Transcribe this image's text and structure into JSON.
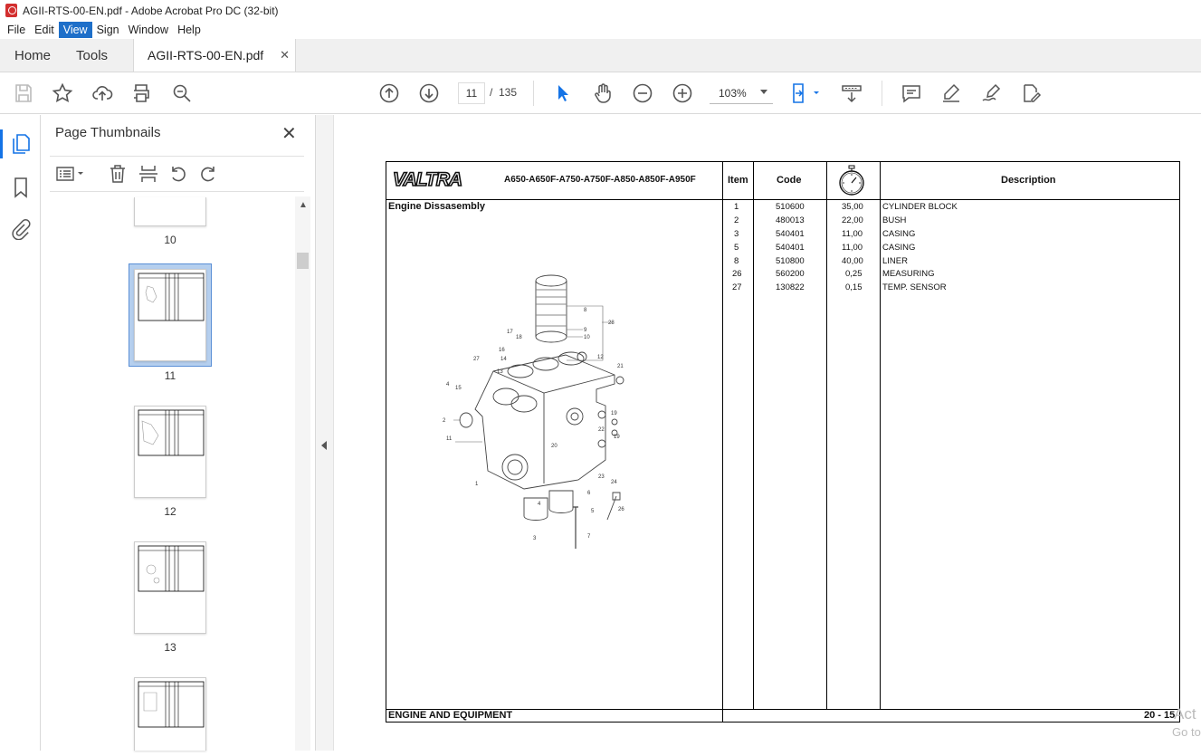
{
  "window": {
    "title": "AGII-RTS-00-EN.pdf - Adobe Acrobat Pro DC (32-bit)"
  },
  "menu": {
    "items": [
      "File",
      "Edit",
      "View",
      "Sign",
      "Window",
      "Help"
    ],
    "active": "View"
  },
  "tabs": {
    "home": "Home",
    "tools": "Tools",
    "document": "AGII-RTS-00-EN.pdf"
  },
  "toolbar": {
    "current_page": "11",
    "page_separator": "/",
    "total_pages": "135",
    "zoom": "103%"
  },
  "thumbnails": {
    "title": "Page Thumbnails",
    "pages": [
      {
        "label": "10"
      },
      {
        "label": "11",
        "selected": true
      },
      {
        "label": "12"
      },
      {
        "label": "13"
      }
    ]
  },
  "document": {
    "brand": "VALTRA",
    "models": "A650-A650F-A750-A750F-A850-A850F-A950F",
    "section_title": "Engine Dissasembly",
    "columns": {
      "item": "Item",
      "code": "Code",
      "description": "Description"
    },
    "rows": [
      {
        "item": "1",
        "code": "510600",
        "time": "35,00",
        "description": "CYLINDER BLOCK"
      },
      {
        "item": "2",
        "code": "480013",
        "time": "22,00",
        "description": "BUSH"
      },
      {
        "item": "3",
        "code": "540401",
        "time": "11,00",
        "description": "CASING"
      },
      {
        "item": "5",
        "code": "540401",
        "time": "11,00",
        "description": "CASING"
      },
      {
        "item": "8",
        "code": "510800",
        "time": "40,00",
        "description": "LINER"
      },
      {
        "item": "26",
        "code": "560200",
        "time": "0,25",
        "description": "MEASURING"
      },
      {
        "item": "27",
        "code": "130822",
        "time": "0,15",
        "description": "TEMP. SENSOR"
      }
    ],
    "footer_left": "ENGINE AND EQUIPMENT",
    "footer_right": "20 - 15",
    "diagram_callouts": [
      "8",
      "9",
      "10",
      "28",
      "17",
      "18",
      "16",
      "14",
      "13",
      "12",
      "27",
      "21",
      "4",
      "15",
      "2",
      "11",
      "19",
      "22",
      "23",
      "24",
      "20",
      "1",
      "6",
      "5",
      "26",
      "4",
      "3",
      "7"
    ]
  },
  "watermark": {
    "line1": "Act",
    "line2": "Go to"
  }
}
